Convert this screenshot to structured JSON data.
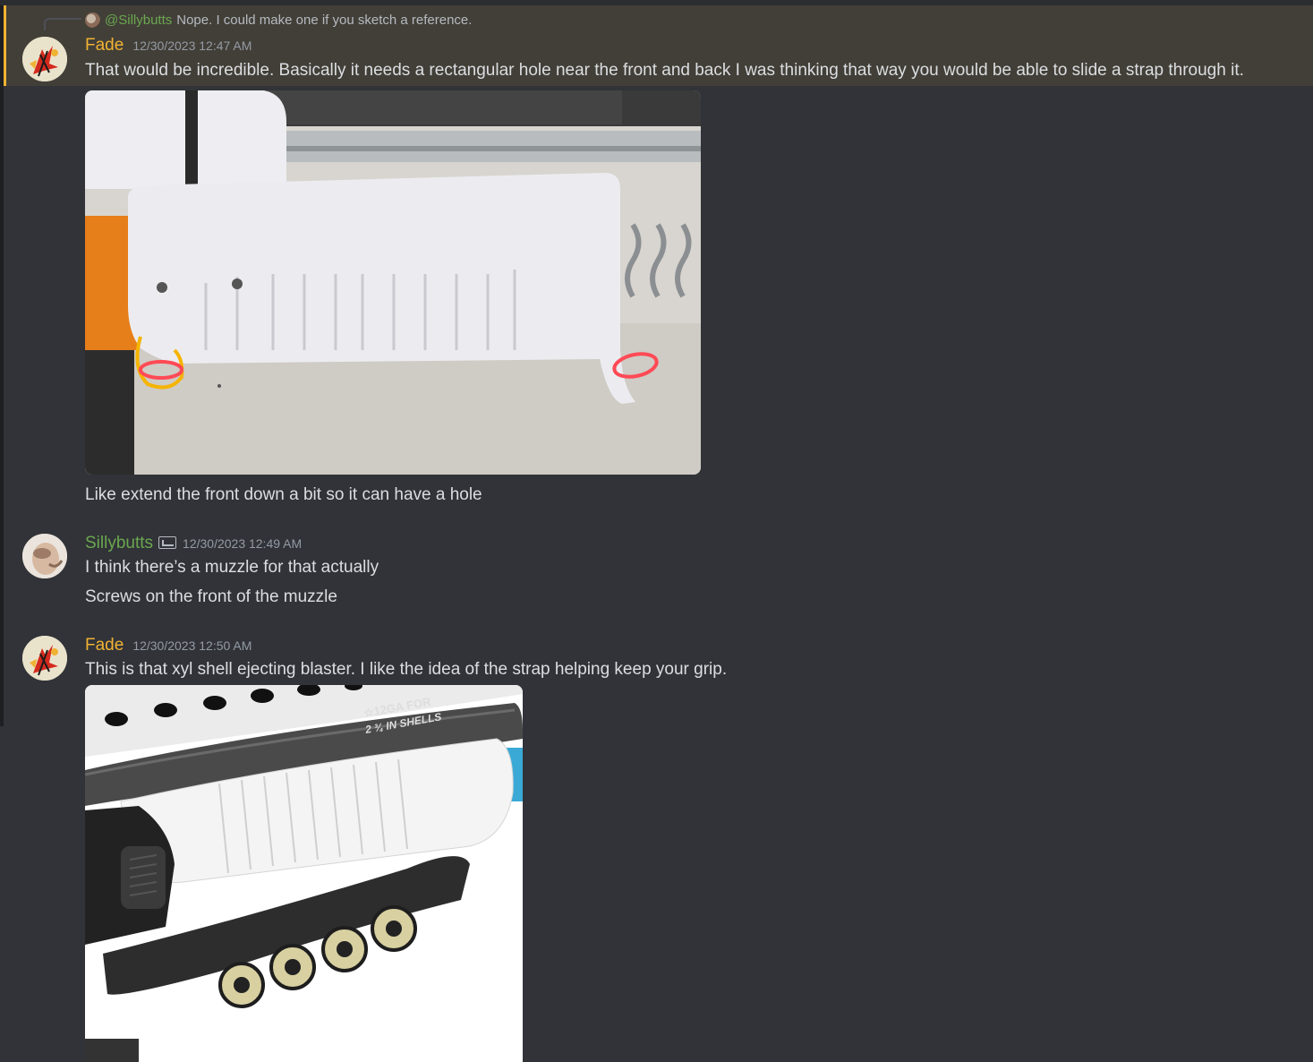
{
  "reply": {
    "username": "@Sillybutts",
    "text": "Nope. I could make one if you sketch a reference."
  },
  "messages": [
    {
      "username": "Fade",
      "timestamp": "12/30/2023 12:47 AM",
      "lines": [
        "That would be incredible. Basically it needs a rectangular hole near the front and back I was thinking that way you would be able to slide a strap through it.",
        "Like extend the front down a bit so it can have a hole"
      ]
    },
    {
      "username": "Sillybutts",
      "timestamp": "12/30/2023 12:49 AM",
      "lines": [
        "I think there’s a muzzle for that actually",
        "Screws on the front of the muzzle"
      ]
    },
    {
      "username": "Fade",
      "timestamp": "12/30/2023 12:50 AM",
      "lines": [
        "This is that xyl shell ejecting blaster. I like the idea of the strap helping keep your grip."
      ]
    }
  ],
  "image2": {
    "printed_text_line1": "☆12GA FOR",
    "printed_text_line2": "2 ¾ IN SHELLS"
  },
  "colors": {
    "background": "#313338",
    "highlight": "#423f38",
    "highlight_bar": "#f0b232",
    "fade_name": "#f0b232",
    "sillybutts_name": "#6aa84f",
    "timestamp": "#949ba4"
  }
}
